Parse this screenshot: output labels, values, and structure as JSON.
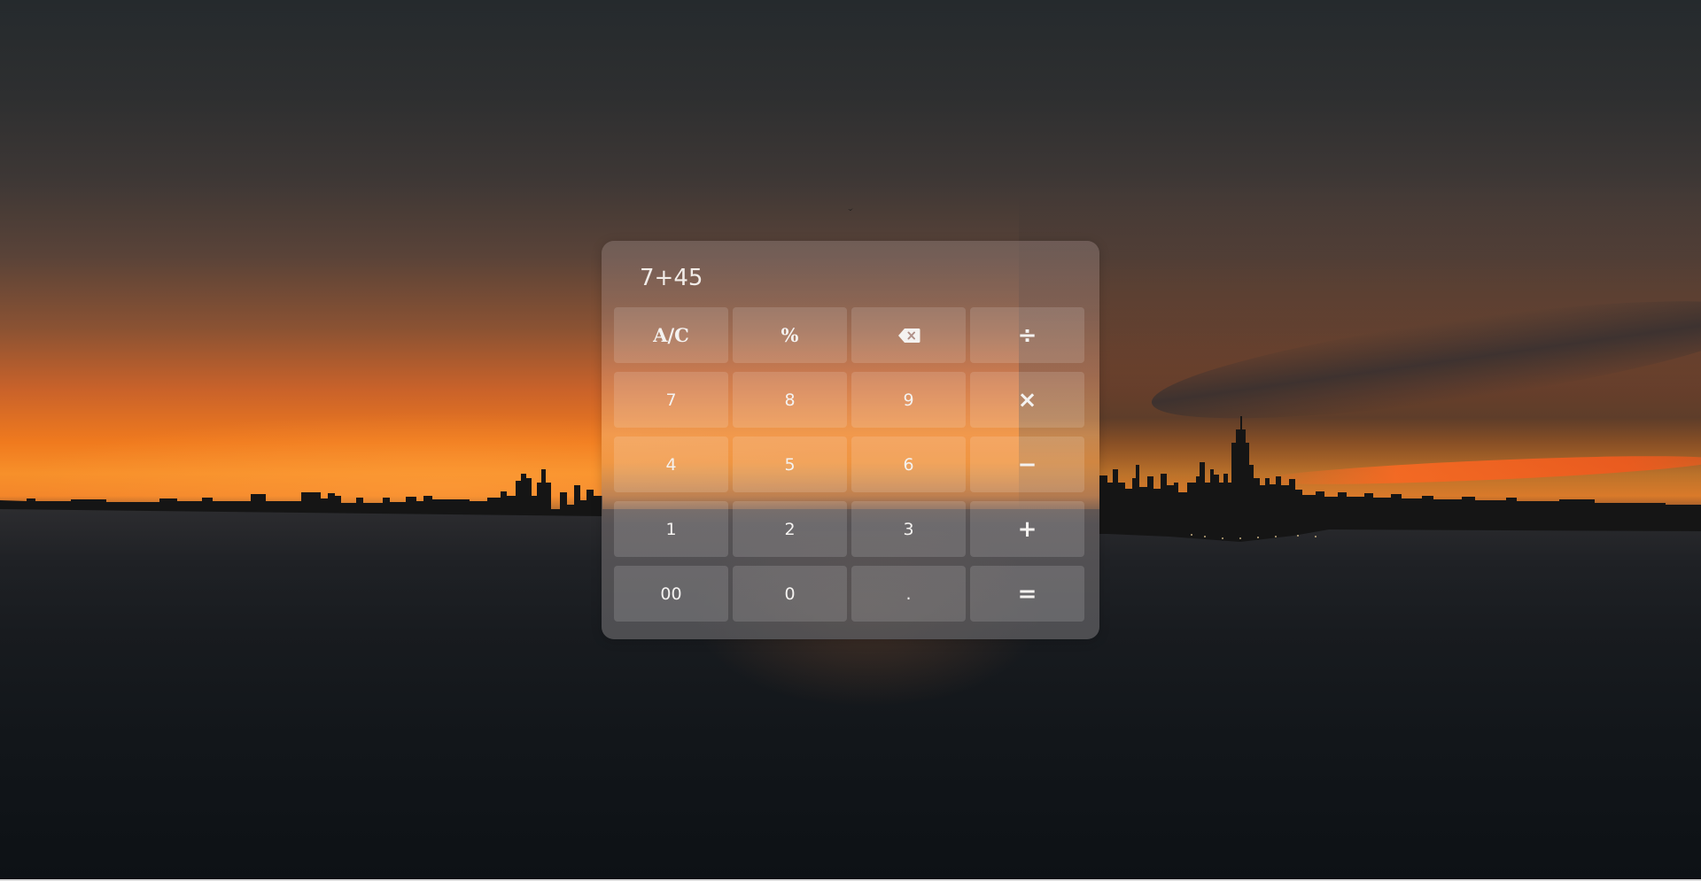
{
  "calculator": {
    "display": "7+45",
    "keys": [
      {
        "label": "A/C",
        "name": "clear-button",
        "kind": "func"
      },
      {
        "label": "%",
        "name": "percent-button",
        "kind": "func"
      },
      {
        "label": "",
        "icon": "backspace-icon",
        "name": "backspace-button",
        "kind": "func"
      },
      {
        "label": "÷",
        "name": "divide-button",
        "kind": "op"
      },
      {
        "label": "7",
        "name": "digit-7-button",
        "kind": "num"
      },
      {
        "label": "8",
        "name": "digit-8-button",
        "kind": "num"
      },
      {
        "label": "9",
        "name": "digit-9-button",
        "kind": "num"
      },
      {
        "label": "×",
        "name": "multiply-button",
        "kind": "op"
      },
      {
        "label": "4",
        "name": "digit-4-button",
        "kind": "num"
      },
      {
        "label": "5",
        "name": "digit-5-button",
        "kind": "num"
      },
      {
        "label": "6",
        "name": "digit-6-button",
        "kind": "num"
      },
      {
        "label": "−",
        "name": "subtract-button",
        "kind": "op"
      },
      {
        "label": "1",
        "name": "digit-1-button",
        "kind": "num"
      },
      {
        "label": "2",
        "name": "digit-2-button",
        "kind": "num"
      },
      {
        "label": "3",
        "name": "digit-3-button",
        "kind": "num"
      },
      {
        "label": "+",
        "name": "add-button",
        "kind": "op"
      },
      {
        "label": "00",
        "name": "double-zero-button",
        "kind": "num"
      },
      {
        "label": "0",
        "name": "digit-0-button",
        "kind": "num"
      },
      {
        "label": ".",
        "name": "decimal-button",
        "kind": "num"
      },
      {
        "label": "=",
        "name": "equals-button",
        "kind": "op"
      }
    ]
  },
  "background": {
    "description_colors": {
      "sky_top": "#252a2d",
      "horizon_orange": "#f07a1e",
      "water": "#12161a"
    }
  }
}
